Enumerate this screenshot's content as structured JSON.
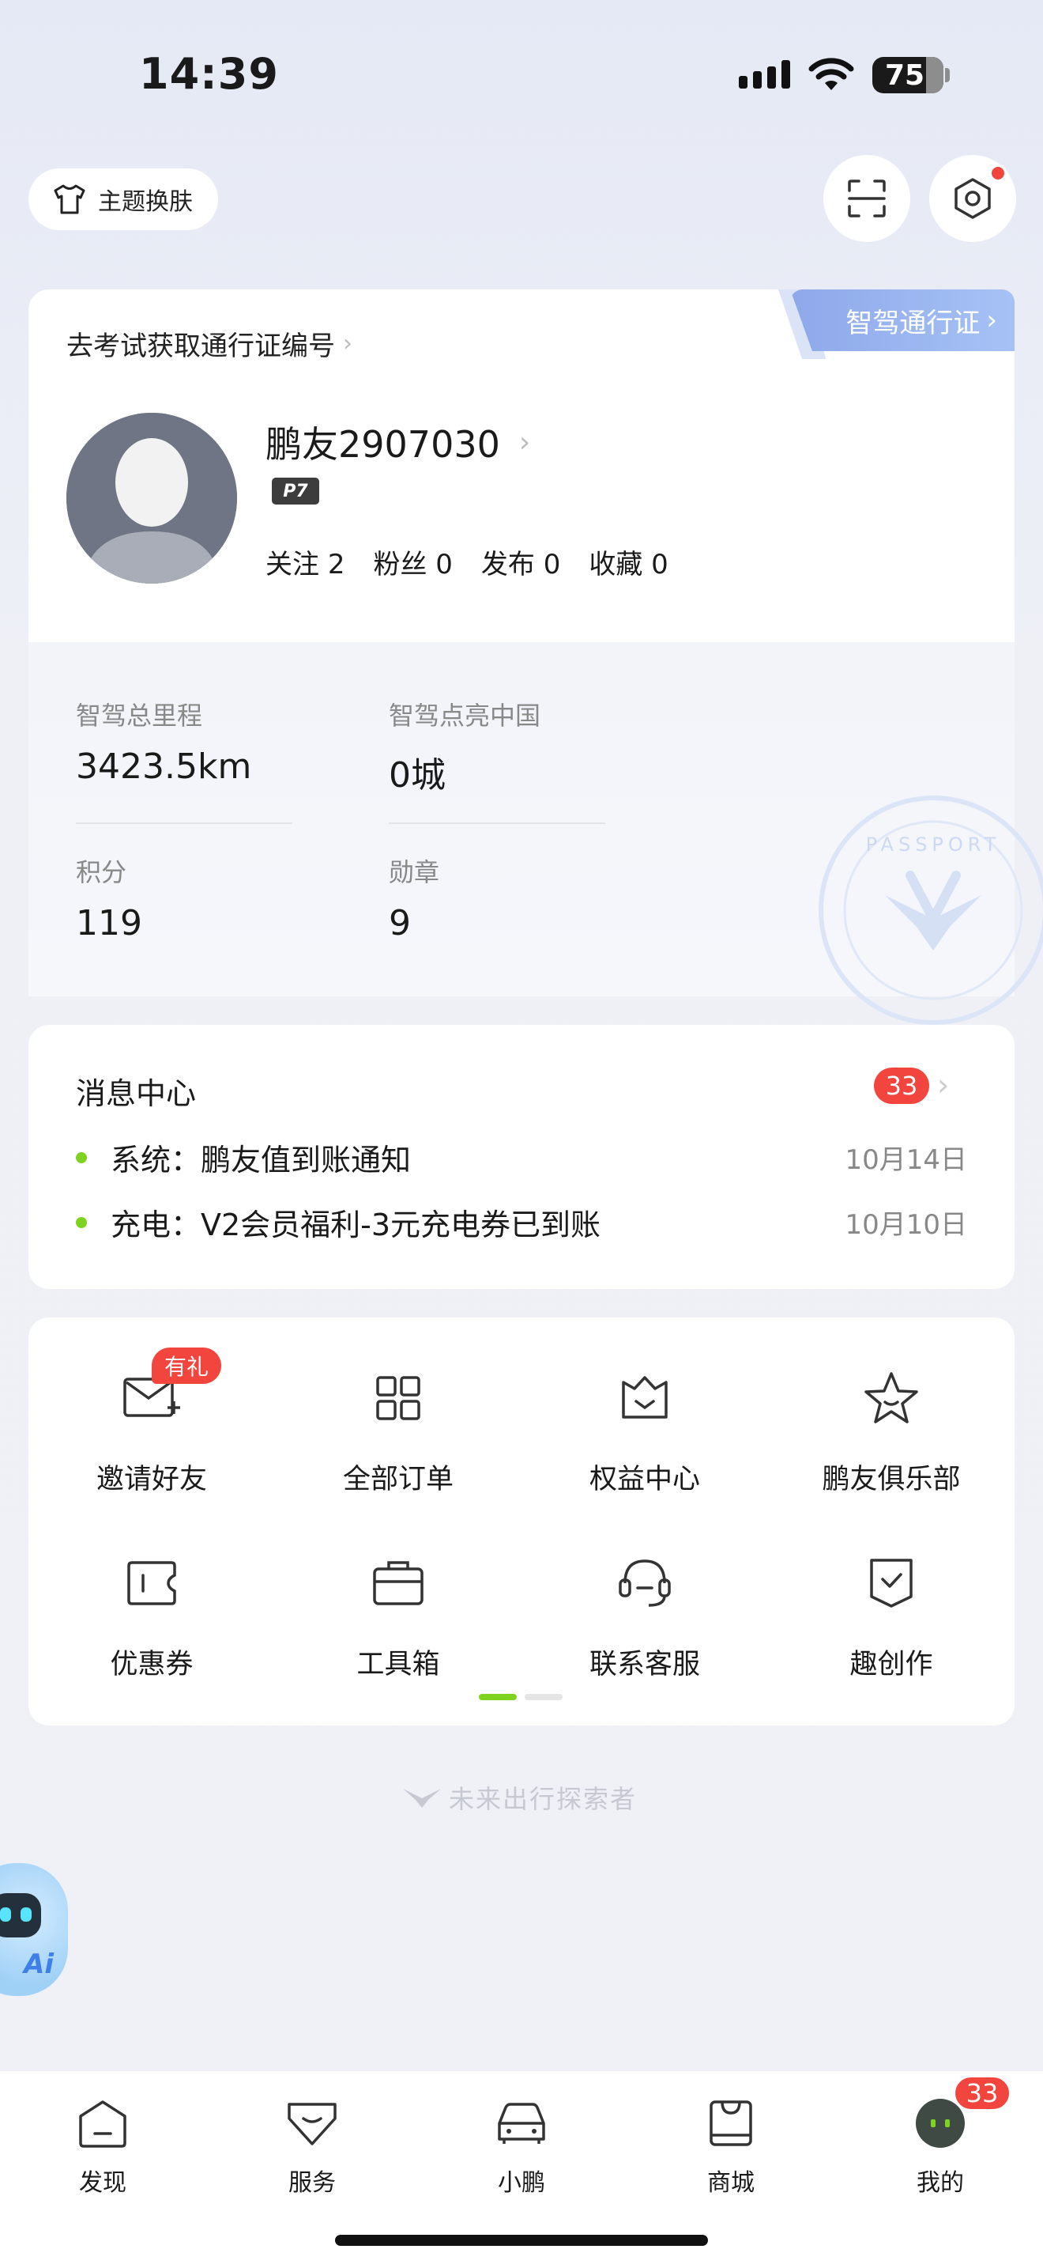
{
  "status_bar": {
    "time": "14:39",
    "battery": "75"
  },
  "top": {
    "theme_label": "主题换肤"
  },
  "profile": {
    "exam_link": "去考试获取通行证编号",
    "passport_tab": "智驾通行证",
    "username": "鹏友2907030",
    "car_model": "P7",
    "social": [
      {
        "label": "关注",
        "value": "2"
      },
      {
        "label": "粉丝",
        "value": "0"
      },
      {
        "label": "发布",
        "value": "0"
      },
      {
        "label": "收藏",
        "value": "0"
      }
    ],
    "stats": [
      {
        "label": "智驾总里程",
        "value": "3423.5km"
      },
      {
        "label": "智驾点亮中国",
        "value": "0城"
      },
      {
        "label": "积分",
        "value": "119"
      },
      {
        "label": "勋章",
        "value": "9"
      }
    ]
  },
  "messages": {
    "title": "消息中心",
    "badge": "33",
    "items": [
      {
        "text": "系统：鹏友值到账通知",
        "date": "10月14日"
      },
      {
        "text": "充电：V2会员福利-3元充电券已到账",
        "date": "10月10日"
      }
    ]
  },
  "grid": {
    "gift_badge": "有礼",
    "items": [
      {
        "label": "邀请好友",
        "icon": "invite-mail-icon"
      },
      {
        "label": "全部订单",
        "icon": "grid-icon"
      },
      {
        "label": "权益中心",
        "icon": "benefits-icon"
      },
      {
        "label": "鹏友俱乐部",
        "icon": "star-icon"
      },
      {
        "label": "优惠券",
        "icon": "coupon-icon"
      },
      {
        "label": "工具箱",
        "icon": "toolbox-icon"
      },
      {
        "label": "联系客服",
        "icon": "headset-icon"
      },
      {
        "label": "趣创作",
        "icon": "create-icon"
      }
    ],
    "page_count": 2,
    "active_page": 1
  },
  "slogan": "未来出行探索者",
  "ai_label": "Ai",
  "tabs": [
    {
      "label": "发现",
      "icon": "discover-icon"
    },
    {
      "label": "服务",
      "icon": "service-icon"
    },
    {
      "label": "小鹏",
      "icon": "car-icon"
    },
    {
      "label": "商城",
      "icon": "mall-icon"
    },
    {
      "label": "我的",
      "icon": "me-avatar"
    }
  ],
  "tab_badge": "33",
  "colors": {
    "accent_red": "#f2453d",
    "accent_green": "#7ed321",
    "passport_blue": "#8ea8ea"
  }
}
